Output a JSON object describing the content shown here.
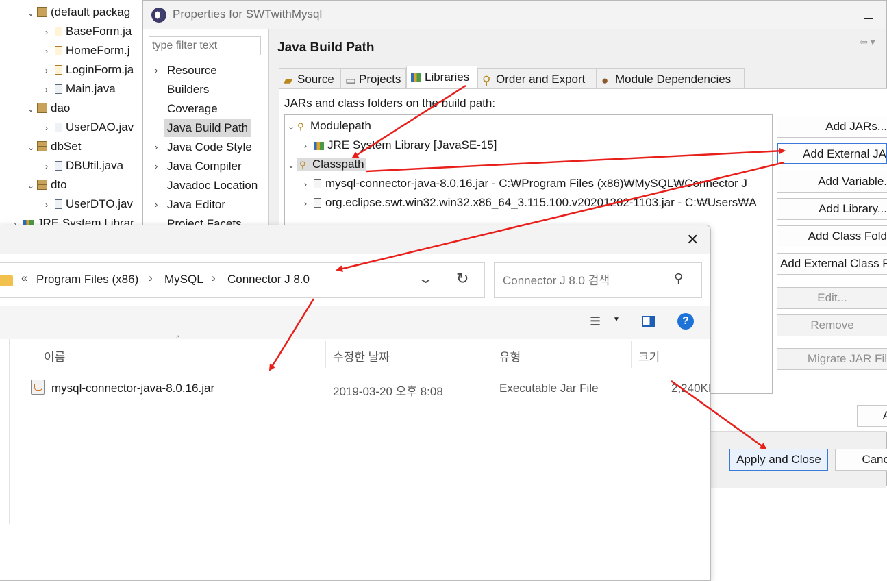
{
  "explorer": {
    "rows": [
      {
        "label": "(default packag",
        "type": "package",
        "expanded": true
      },
      {
        "label": "BaseForm.ja",
        "type": "form"
      },
      {
        "label": "HomeForm.j",
        "type": "form"
      },
      {
        "label": "LoginForm.ja",
        "type": "form"
      },
      {
        "label": "Main.java",
        "type": "file"
      },
      {
        "label": "dao",
        "type": "package",
        "expanded": true
      },
      {
        "label": "UserDAO.jav",
        "type": "file"
      },
      {
        "label": "dbSet",
        "type": "package",
        "expanded": true
      },
      {
        "label": "DBUtil.java",
        "type": "file"
      },
      {
        "label": "dto",
        "type": "package",
        "expanded": true
      },
      {
        "label": "UserDTO.jav",
        "type": "file"
      },
      {
        "label": "JRE System Librar",
        "type": "library"
      }
    ]
  },
  "properties": {
    "title": "Properties for SWTwithMysql",
    "filter_placeholder": "type filter text",
    "nav": [
      {
        "label": "Resource",
        "expandable": true
      },
      {
        "label": "Builders",
        "expandable": false
      },
      {
        "label": "Coverage",
        "expandable": false
      },
      {
        "label": "Java Build Path",
        "expandable": false,
        "selected": true
      },
      {
        "label": "Java Code Style",
        "expandable": true
      },
      {
        "label": "Java Compiler",
        "expandable": true
      },
      {
        "label": "Javadoc Location",
        "expandable": false
      },
      {
        "label": "Java Editor",
        "expandable": true
      },
      {
        "label": "Project Facets",
        "expandable": false
      }
    ],
    "page_title": "Java Build Path",
    "nav_arrows": "⇦ ▾",
    "tabs": [
      {
        "label": "Source"
      },
      {
        "label": "Projects"
      },
      {
        "label": "Libraries",
        "active": true
      },
      {
        "label": "Order and Export"
      },
      {
        "label": "Module Dependencies"
      }
    ],
    "libs_label": "JARs and class folders on the build path:",
    "tree": {
      "modulepath": "Modulepath",
      "jre": "JRE System Library [JavaSE-15]",
      "classpath": "Classpath",
      "jars": [
        "mysql-connector-java-8.0.16.jar - C:₩Program Files (x86)₩MySQL₩Connector J",
        "org.eclipse.swt.win32.win32.x86_64_3.115.100.v20201202-1103.jar - C:₩Users₩A"
      ]
    },
    "buttons": [
      {
        "label": "Add JARs...",
        "enabled": true
      },
      {
        "label": "Add External JA",
        "enabled": true,
        "highlight": true
      },
      {
        "label": "Add Variable.",
        "enabled": true
      },
      {
        "label": "Add Library...",
        "enabled": true
      },
      {
        "label": "Add Class Fold",
        "enabled": true
      },
      {
        "label": "Add External Class F",
        "enabled": true
      },
      {
        "label": "Edit...",
        "enabled": false
      },
      {
        "label": "Remove",
        "enabled": false
      },
      {
        "label": "Migrate JAR Fil",
        "enabled": false
      }
    ],
    "apply_small": "A",
    "apply_close": "Apply and Close",
    "cancel": "Canc"
  },
  "chooser": {
    "breadcrumb": [
      "Program Files (x86)",
      "MySQL",
      "Connector J 8.0"
    ],
    "breadcrumb_prefix": "«",
    "search_placeholder": "Connector J 8.0 검색",
    "columns": {
      "name": "이름",
      "date": "수정한 날짜",
      "type": "유형",
      "size": "크기"
    },
    "files": [
      {
        "name": "mysql-connector-java-8.0.16.jar",
        "date": "2019-03-20 오후 8:08",
        "type": "Executable Jar File",
        "size": "2,240KI"
      }
    ]
  },
  "colors": {
    "annotation_arrow": "#e8201c",
    "accent": "#3a7ad8"
  }
}
